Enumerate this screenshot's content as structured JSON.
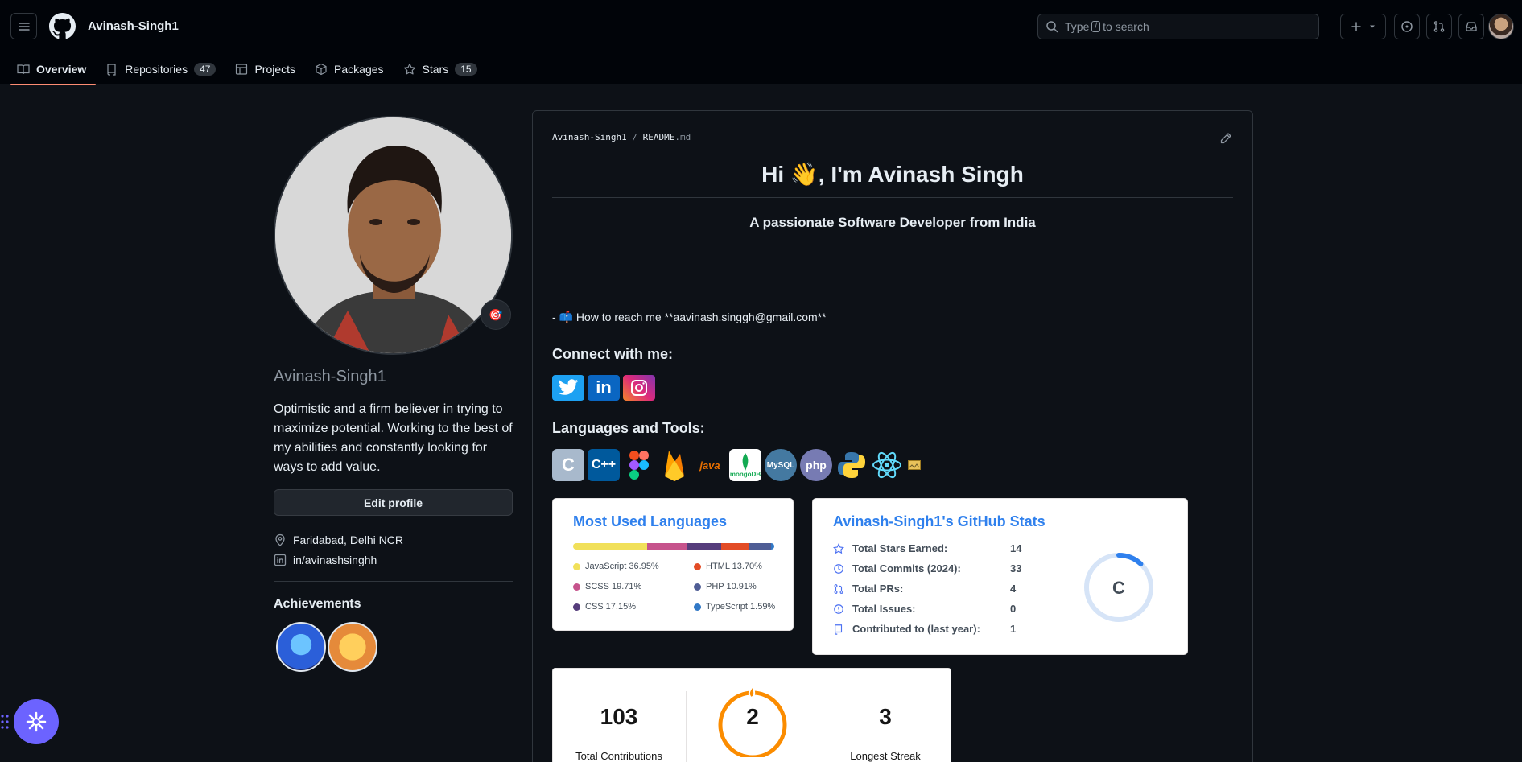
{
  "header": {
    "owner": "Avinash-Singh1",
    "search_placeholder_pre": "Type",
    "search_slash": "/",
    "search_placeholder_post": "to search"
  },
  "tabs": [
    {
      "label": "Overview",
      "icon": "book-icon",
      "active": true
    },
    {
      "label": "Repositories",
      "icon": "repo-icon",
      "count": "47"
    },
    {
      "label": "Projects",
      "icon": "table-icon"
    },
    {
      "label": "Packages",
      "icon": "package-icon"
    },
    {
      "label": "Stars",
      "icon": "star-icon",
      "count": "15"
    }
  ],
  "sidebar": {
    "status_emoji": "🎯",
    "username": "Avinash-Singh1",
    "bio": "Optimistic and a firm believer in trying to maximize potential. Working to the best of my abilities and constantly looking for ways to add value.",
    "edit_label": "Edit profile",
    "location": "Faridabad, Delhi NCR",
    "linkedin": "in/avinashsinghh",
    "achievements_title": "Achievements"
  },
  "readme": {
    "crumb_owner": "Avinash-Singh1",
    "crumb_sep": "/",
    "crumb_file": "README",
    "crumb_ext": ".md",
    "title": "Hi 👋, I'm Avinash Singh",
    "subtitle": "A passionate Software Developer from India",
    "reach": "- 📫 How to reach me **aavinash.singgh@gmail.com**",
    "connect_title": "Connect with me:",
    "tools_title": "Languages and Tools:",
    "social_icons": [
      "twitter-icon",
      "linkedin-icon",
      "instagram-icon"
    ],
    "tool_icons": [
      "c-icon",
      "cplusplus-icon",
      "figma-icon",
      "firebase-icon",
      "java-icon",
      "mongodb-icon",
      "mysql-icon",
      "php-icon",
      "python-icon",
      "react-icon",
      "broken-image-icon"
    ],
    "tool_labels": {
      "java": "java",
      "mongodb": "mongoDB",
      "mysql": "MySQL",
      "php": "php"
    }
  },
  "langs_card": {
    "title": "Most Used Languages",
    "items": [
      {
        "label": "JavaScript 36.95%",
        "color": "#f1e05a",
        "percent": 36.95
      },
      {
        "label": "HTML 13.70%",
        "color": "#e34c26",
        "percent": 13.7
      },
      {
        "label": "SCSS 19.71%",
        "color": "#c6538c",
        "percent": 19.71
      },
      {
        "label": "PHP 10.91%",
        "color": "#4F5D95",
        "percent": 10.91
      },
      {
        "label": "CSS 17.15%",
        "color": "#563d7c",
        "percent": 17.15
      },
      {
        "label": "TypeScript 1.59%",
        "color": "#3178c6",
        "percent": 1.59
      }
    ]
  },
  "stats_card": {
    "title": "Avinash-Singh1's GitHub Stats",
    "rows": [
      {
        "label": "Total Stars Earned:",
        "value": "14",
        "icon": "star-icon"
      },
      {
        "label": "Total Commits (2024):",
        "value": "33",
        "icon": "history-icon"
      },
      {
        "label": "Total PRs:",
        "value": "4",
        "icon": "pull-request-icon"
      },
      {
        "label": "Total Issues:",
        "value": "0",
        "icon": "issue-icon"
      },
      {
        "label": "Contributed to (last year):",
        "value": "1",
        "icon": "repo-icon"
      }
    ],
    "rank": "C",
    "rank_progress": 0.12
  },
  "streak_card": {
    "total": "103",
    "total_label": "Total Contributions",
    "current": "2",
    "longest": "3",
    "longest_label": "Longest Streak"
  },
  "colors": {
    "accent": "#fd8c73",
    "link": "#2f80ed",
    "bg": "#0d1117"
  }
}
